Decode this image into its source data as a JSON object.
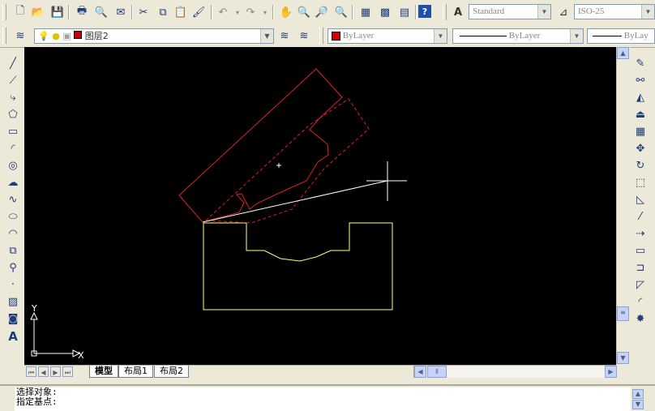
{
  "toolbar1": {
    "text_style": "Standard",
    "dim_style": "ISO-25"
  },
  "toolbar2": {
    "layer_name": "图层2",
    "color": "ByLayer",
    "linetype": "ByLayer",
    "lineweight": "ByLay"
  },
  "tabs": [
    {
      "label": "模型"
    },
    {
      "label": "布局1"
    },
    {
      "label": "布局2"
    }
  ],
  "ucs": {
    "x_label": "X",
    "y_label": "Y"
  },
  "command": {
    "line1": "选择对象:",
    "line2": "指定基点:"
  },
  "colors": {
    "layer_swatch": "#cc0000",
    "yellow_shape": "#ffff80",
    "red_shape": "#e02020"
  }
}
